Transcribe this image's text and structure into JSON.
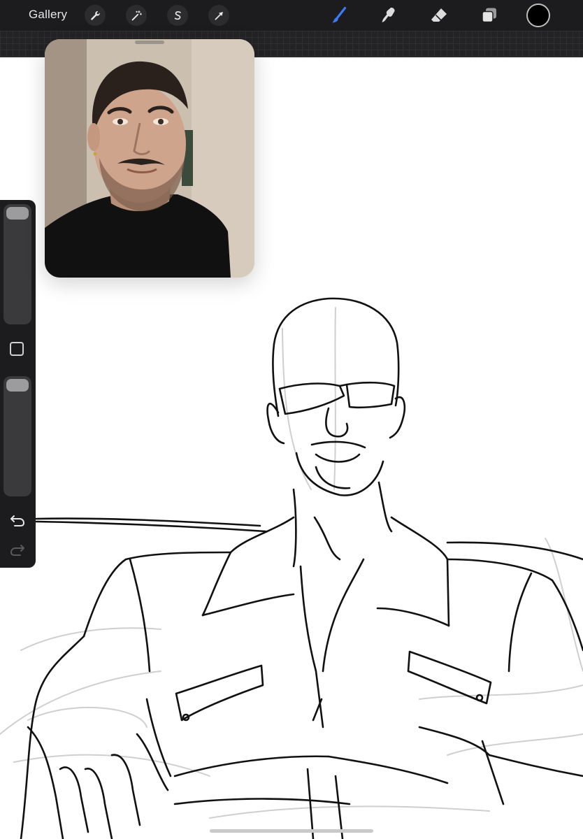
{
  "toolbar": {
    "gallery_label": "Gallery",
    "actions_icon": "wrench-icon",
    "adjustments_icon": "magic-wand-icon",
    "selection_icon": "selection-s-icon",
    "transform_icon": "arrow-cursor-icon",
    "brush_icon": "brush-icon",
    "smudge_icon": "smudge-finger-icon",
    "eraser_icon": "eraser-icon",
    "layers_icon": "layers-icon",
    "current_color": "#000000",
    "active_tool_color": "#3d7bf4"
  },
  "reference_window": {
    "content": "reference-photo"
  },
  "sidebar": {
    "brush_size_icon": "brush-size-slider",
    "modify_icon": "square-modify-icon",
    "opacity_icon": "brush-opacity-slider",
    "undo_icon": "undo-arrow-icon",
    "redo_icon": "redo-arrow-icon"
  },
  "canvas": {
    "content": "line-art-sketch"
  }
}
